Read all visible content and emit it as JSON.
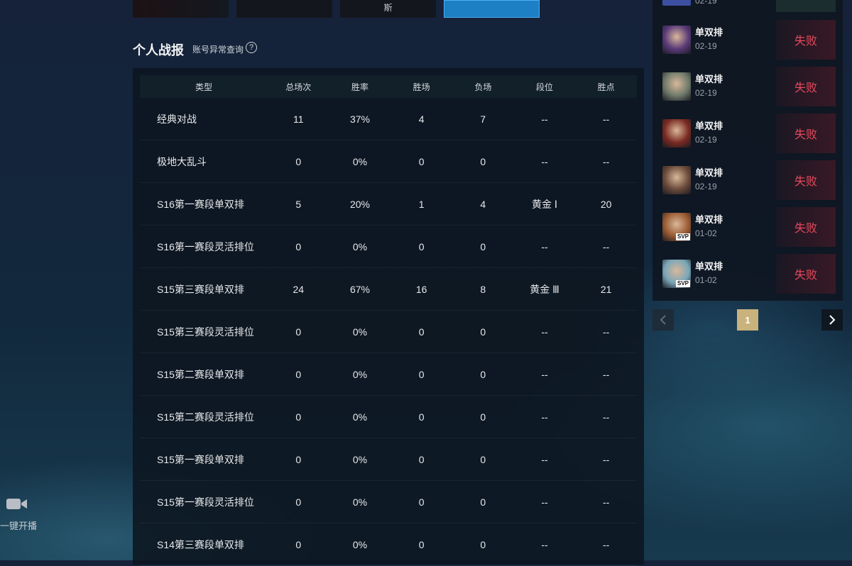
{
  "top_thumbnails": [
    {
      "caption": ""
    },
    {
      "caption": ""
    },
    {
      "caption": "斯"
    },
    {
      "caption": ""
    }
  ],
  "section": {
    "title": "个人战报",
    "abnormal_query_link": "账号异常查询",
    "help_glyph": "?"
  },
  "stats_table": {
    "headers": [
      "类型",
      "总场次",
      "胜率",
      "胜场",
      "负场",
      "段位",
      "胜点"
    ],
    "rows": [
      [
        "经典对战",
        "11",
        "37%",
        "4",
        "7",
        "--",
        "--"
      ],
      [
        "极地大乱斗",
        "0",
        "0%",
        "0",
        "0",
        "--",
        "--"
      ],
      [
        "S16第一赛段单双排",
        "5",
        "20%",
        "1",
        "4",
        "黄金 Ⅰ",
        "20"
      ],
      [
        "S16第一赛段灵活排位",
        "0",
        "0%",
        "0",
        "0",
        "--",
        "--"
      ],
      [
        "S15第三赛段单双排",
        "24",
        "67%",
        "16",
        "8",
        "黄金 Ⅲ",
        "21"
      ],
      [
        "S15第三赛段灵活排位",
        "0",
        "0%",
        "0",
        "0",
        "--",
        "--"
      ],
      [
        "S15第二赛段单双排",
        "0",
        "0%",
        "0",
        "0",
        "--",
        "--"
      ],
      [
        "S15第二赛段灵活排位",
        "0",
        "0%",
        "0",
        "0",
        "--",
        "--"
      ],
      [
        "S15第一赛段单双排",
        "0",
        "0%",
        "0",
        "0",
        "--",
        "--"
      ],
      [
        "S15第一赛段灵活排位",
        "0",
        "0%",
        "0",
        "0",
        "--",
        "--"
      ],
      [
        "S14第三赛段单双排",
        "0",
        "0%",
        "0",
        "0",
        "--",
        "--"
      ]
    ]
  },
  "match_history": {
    "partial_top_date": "02-19",
    "items": [
      {
        "mode": "单双排",
        "date": "02-19",
        "result": "失败",
        "svp": "",
        "avatar_color": "#5a3a78"
      },
      {
        "mode": "单双排",
        "date": "02-19",
        "result": "失败",
        "svp": "",
        "avatar_color": "#6f7a6a"
      },
      {
        "mode": "单双排",
        "date": "02-19",
        "result": "失败",
        "svp": "",
        "avatar_color": "#7a2a22"
      },
      {
        "mode": "单双排",
        "date": "02-19",
        "result": "失败",
        "svp": "",
        "avatar_color": "#6a4a3a"
      },
      {
        "mode": "单双排",
        "date": "01-02",
        "result": "失败",
        "svp": "SVP",
        "avatar_color": "#9a5a32"
      },
      {
        "mode": "单双排",
        "date": "01-02",
        "result": "失败",
        "svp": "SVP",
        "avatar_color": "#7aa6b8"
      }
    ]
  },
  "pagination": {
    "current_page": "1"
  },
  "live_stream": {
    "label": "一键开播"
  },
  "colors": {
    "accent_gold": "#c9b27c",
    "loss_red": "#e8485c",
    "selected_blue": "#1d7fc4"
  }
}
